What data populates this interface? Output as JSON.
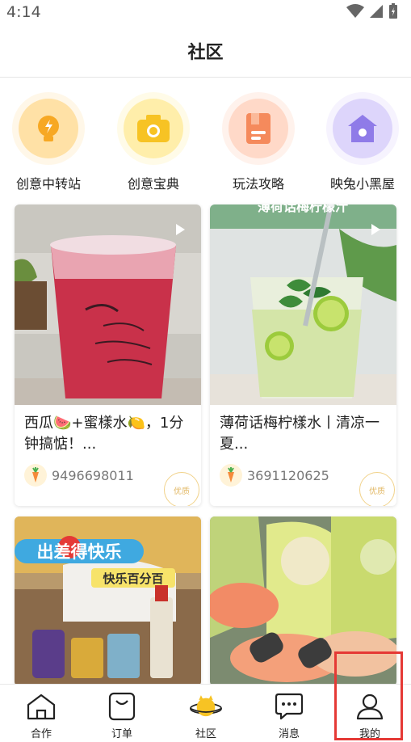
{
  "status_bar": {
    "time": "4:14"
  },
  "header": {
    "title": "社区"
  },
  "categories": [
    {
      "label": "创意中转站",
      "icon": "lightbulb-icon",
      "color": "#f7a823",
      "bg": "#fff2d6"
    },
    {
      "label": "创意宝典",
      "icon": "camera-icon",
      "color": "#f7c324",
      "bg": "#fff7d9"
    },
    {
      "label": "玩法攻略",
      "icon": "book-icon",
      "color": "#f58a5c",
      "bg": "#ffe8dc"
    },
    {
      "label": "映兔小黑屋",
      "icon": "house-icon",
      "color": "#8f7be8",
      "bg": "#ece8fc"
    }
  ],
  "feed": [
    {
      "title": "西瓜🍉+蜜樣水🍋，1分钟搞惦！...",
      "user_id": "9496698011",
      "badge": "优质",
      "media": "video"
    },
    {
      "title": "薄荷话梅柠樣水丨清凉一夏...",
      "user_id": "3691120625",
      "badge": "优质",
      "media": "video",
      "overlay_text": "薄荷话梅柠檬汁"
    },
    {
      "overlay_line1": "出差得快乐",
      "overlay_line2": "快乐百分百"
    },
    {
      "overlay_text": ""
    }
  ],
  "bottom_nav": [
    {
      "label": "合作",
      "icon": "house-outline-icon"
    },
    {
      "label": "订单",
      "icon": "bag-icon"
    },
    {
      "label": "社区",
      "icon": "planet-icon",
      "active": true
    },
    {
      "label": "消息",
      "icon": "chat-bubble-icon"
    },
    {
      "label": "我的",
      "icon": "person-icon"
    }
  ],
  "colors": {
    "accent": "#f7c324",
    "highlight": "#e53935"
  }
}
